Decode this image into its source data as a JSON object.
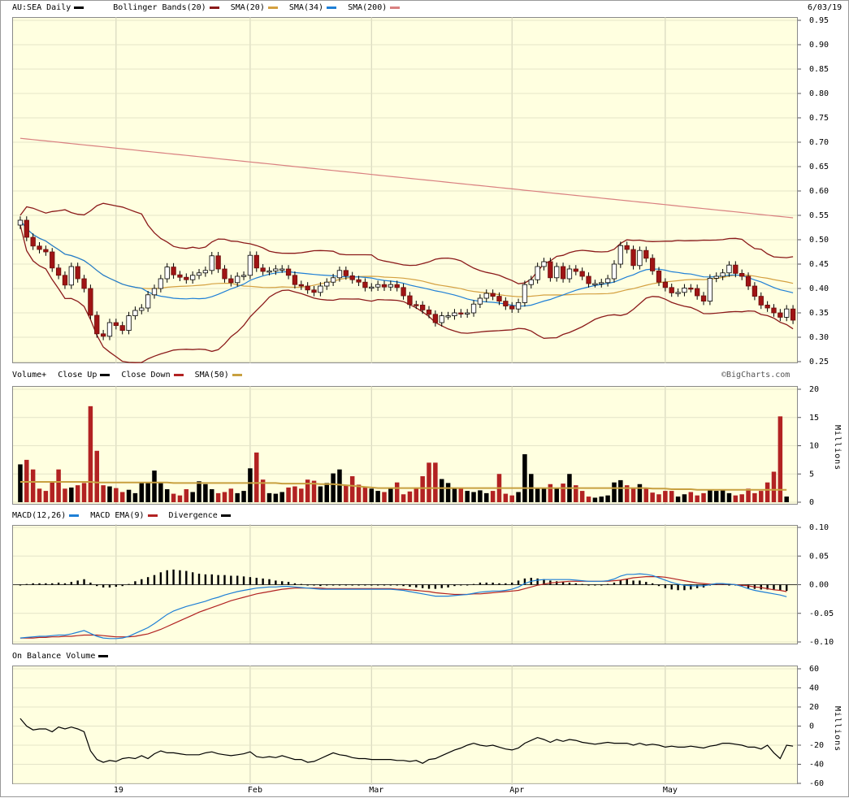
{
  "header": {
    "ticker": "AU:SEA Daily",
    "date": "6/03/19",
    "legend": [
      {
        "label": "AU:SEA Daily",
        "color": "#000000"
      },
      {
        "label": "Bollinger Bands(20)",
        "color": "#8b1a1a"
      },
      {
        "label": "SMA(20)",
        "color": "#b22222"
      },
      {
        "label": "SMA(34)",
        "color": "#d4a040"
      },
      {
        "label": "SMA(200)",
        "color": "#1e7fd6"
      },
      {
        "label": "",
        "color": "#d98080"
      }
    ]
  },
  "volume_panel": {
    "legend": [
      {
        "label": "Volume+",
        "color": null
      },
      {
        "label": "Close Up",
        "color": "#000000"
      },
      {
        "label": "Close Down",
        "color": "#b22222"
      },
      {
        "label": "SMA(50)",
        "color": "#c8a040"
      }
    ],
    "watermark": "©BigCharts.com",
    "unit_label": "Millions"
  },
  "macd_panel": {
    "legend": [
      {
        "label": "MACD(12,26)",
        "color": "#1e7fd6"
      },
      {
        "label": "MACD EMA(9)",
        "color": "#b22222"
      },
      {
        "label": "Divergence",
        "color": "#000000"
      }
    ]
  },
  "obv_panel": {
    "legend": [
      {
        "label": "On Balance Volume",
        "color": "#000000"
      }
    ],
    "unit_label": "Millions"
  },
  "x_axis": {
    "labels": [
      "19",
      "Feb",
      "Mar",
      "Apr",
      "May"
    ]
  },
  "chart_data": {
    "type": "candlestick",
    "title": "AU:SEA Daily",
    "price_ylim": [
      0.25,
      0.95
    ],
    "price_ticks": [
      "0.95",
      "0.90",
      "0.85",
      "0.80",
      "0.75",
      "0.70",
      "0.65",
      "0.60",
      "0.55",
      "0.50",
      "0.45",
      "0.40",
      "0.35",
      "0.30",
      "0.25"
    ],
    "volume_ylim": [
      0,
      20
    ],
    "volume_ticks": [
      "20",
      "15",
      "10",
      "5",
      "0"
    ],
    "macd_ylim": [
      -0.1,
      0.1
    ],
    "macd_ticks": [
      "0.10",
      "0.05",
      "0.00",
      "-0.05",
      "-0.10"
    ],
    "obv_ylim": [
      -60,
      60
    ],
    "obv_ticks": [
      "60",
      "40",
      "20",
      "0",
      "-20",
      "-40",
      "-60"
    ],
    "close": [
      0.54,
      0.505,
      0.487,
      0.48,
      0.475,
      0.442,
      0.427,
      0.407,
      0.445,
      0.42,
      0.4,
      0.345,
      0.307,
      0.302,
      0.33,
      0.324,
      0.314,
      0.344,
      0.355,
      0.36,
      0.387,
      0.4,
      0.42,
      0.444,
      0.428,
      0.423,
      0.418,
      0.427,
      0.432,
      0.437,
      0.467,
      0.44,
      0.42,
      0.412,
      0.425,
      0.427,
      0.468,
      0.442,
      0.435,
      0.436,
      0.44,
      0.44,
      0.427,
      0.408,
      0.405,
      0.397,
      0.392,
      0.405,
      0.413,
      0.422,
      0.437,
      0.426,
      0.418,
      0.413,
      0.402,
      0.403,
      0.408,
      0.403,
      0.408,
      0.402,
      0.385,
      0.367,
      0.366,
      0.356,
      0.347,
      0.33,
      0.344,
      0.344,
      0.35,
      0.348,
      0.35,
      0.368,
      0.38,
      0.39,
      0.384,
      0.374,
      0.364,
      0.358,
      0.371,
      0.408,
      0.418,
      0.445,
      0.455,
      0.422,
      0.445,
      0.42,
      0.44,
      0.435,
      0.425,
      0.41,
      0.41,
      0.412,
      0.42,
      0.45,
      0.488,
      0.48,
      0.447,
      0.478,
      0.462,
      0.436,
      0.413,
      0.402,
      0.391,
      0.392,
      0.401,
      0.4,
      0.385,
      0.374,
      0.421,
      0.425,
      0.432,
      0.448,
      0.431,
      0.425,
      0.405,
      0.384,
      0.366,
      0.36,
      0.35,
      0.341,
      0.358,
      0.335
    ],
    "volume": [
      6.7,
      7.5,
      5.8,
      2.4,
      2.0,
      3.5,
      5.8,
      2.4,
      2.6,
      3.0,
      3.4,
      17.0,
      9.1,
      3.0,
      2.8,
      2.5,
      1.8,
      2.2,
      1.6,
      3.5,
      3.5,
      5.6,
      3.6,
      2.3,
      1.5,
      1.2,
      2.3,
      1.8,
      3.7,
      3.2,
      2.3,
      1.6,
      1.8,
      2.4,
      1.6,
      2.0,
      6.0,
      8.8,
      4.0,
      1.6,
      1.5,
      1.8,
      2.6,
      2.8,
      2.4,
      4.0,
      3.8,
      2.8,
      3.4,
      5.1,
      5.8,
      3.0,
      4.6,
      3.1,
      2.7,
      2.4,
      2.0,
      1.8,
      2.6,
      3.5,
      1.4,
      1.9,
      2.6,
      4.6,
      7.0,
      7.0,
      4.1,
      3.4,
      2.4,
      2.4,
      2.0,
      1.8,
      2.1,
      1.6,
      2.0,
      5.0,
      1.5,
      1.2,
      1.8,
      8.5,
      5.0,
      2.4,
      2.4,
      3.2,
      2.4,
      3.3,
      5.0,
      3.0,
      2.0,
      1.0,
      0.8,
      1.0,
      1.2,
      3.5,
      3.9,
      3.0,
      2.4,
      3.2,
      2.4,
      1.7,
      1.4,
      2.0,
      2.0,
      1.0,
      1.4,
      1.8,
      1.2,
      1.6,
      2.2,
      2.0,
      2.1,
      1.6,
      1.2,
      1.4,
      2.4,
      1.6,
      2.0,
      3.5,
      5.4,
      15.2,
      1.0
    ],
    "sma50_volume": [
      3.6,
      3.6,
      3.6,
      3.6,
      3.6,
      3.6,
      3.6,
      3.6,
      3.6,
      3.6,
      3.6,
      3.6,
      3.5,
      3.5,
      3.5,
      3.5,
      3.5,
      3.5,
      3.5,
      3.5,
      3.5,
      3.5,
      3.5,
      3.5,
      3.4,
      3.4,
      3.4,
      3.4,
      3.4,
      3.4,
      3.4,
      3.4,
      3.4,
      3.4,
      3.4,
      3.4,
      3.4,
      3.4,
      3.4,
      3.4,
      3.4,
      3.3,
      3.3,
      3.3,
      3.3,
      3.3,
      3.3,
      3.2,
      3.2,
      3.2,
      3.1,
      3.0,
      2.9,
      2.8,
      2.7,
      2.6,
      2.5,
      2.5,
      2.5,
      2.5,
      2.5,
      2.5,
      2.5,
      2.5,
      2.5,
      2.5,
      2.5,
      2.5,
      2.5,
      2.5,
      2.5,
      2.5,
      2.5,
      2.5,
      2.5,
      2.5,
      2.5,
      2.5,
      2.5,
      2.5,
      2.5,
      2.5,
      2.5,
      2.5,
      2.5,
      2.5,
      2.5,
      2.5,
      2.5,
      2.5,
      2.5,
      2.5,
      2.5,
      2.5,
      2.5,
      2.5,
      2.5,
      2.5,
      2.5,
      2.4,
      2.4,
      2.4,
      2.3,
      2.3,
      2.3,
      2.3,
      2.2,
      2.2,
      2.2,
      2.2,
      2.2,
      2.2,
      2.2,
      2.2,
      2.2,
      2.2,
      2.2,
      2.2,
      2.2,
      2.2,
      2.2
    ],
    "sma200_start": 0.708,
    "sma200_end": 0.545,
    "macd_line": [
      -0.093,
      -0.092,
      -0.091,
      -0.09,
      -0.09,
      -0.089,
      -0.088,
      -0.088,
      -0.086,
      -0.083,
      -0.08,
      -0.085,
      -0.09,
      -0.093,
      -0.094,
      -0.094,
      -0.093,
      -0.09,
      -0.085,
      -0.08,
      -0.075,
      -0.068,
      -0.06,
      -0.052,
      -0.046,
      -0.042,
      -0.038,
      -0.035,
      -0.032,
      -0.029,
      -0.025,
      -0.022,
      -0.018,
      -0.015,
      -0.012,
      -0.01,
      -0.008,
      -0.006,
      -0.005,
      -0.004,
      -0.004,
      -0.003,
      -0.003,
      -0.004,
      -0.005,
      -0.006,
      -0.007,
      -0.008,
      -0.008,
      -0.008,
      -0.008,
      -0.008,
      -0.008,
      -0.008,
      -0.008,
      -0.008,
      -0.008,
      -0.008,
      -0.008,
      -0.009,
      -0.01,
      -0.012,
      -0.014,
      -0.016,
      -0.018,
      -0.02,
      -0.02,
      -0.02,
      -0.019,
      -0.018,
      -0.017,
      -0.015,
      -0.013,
      -0.012,
      -0.011,
      -0.011,
      -0.01,
      -0.008,
      -0.004,
      0.002,
      0.006,
      0.008,
      0.009,
      0.009,
      0.009,
      0.009,
      0.009,
      0.008,
      0.007,
      0.006,
      0.006,
      0.006,
      0.007,
      0.01,
      0.015,
      0.018,
      0.018,
      0.019,
      0.018,
      0.016,
      0.012,
      0.008,
      0.004,
      0.001,
      -0.001,
      -0.002,
      -0.002,
      -0.002,
      0.0,
      0.002,
      0.002,
      0.001,
      0.0,
      -0.003,
      -0.007,
      -0.01,
      -0.012,
      -0.014,
      -0.016,
      -0.018,
      -0.021
    ],
    "macd_signal": [
      -0.093,
      -0.093,
      -0.093,
      -0.092,
      -0.092,
      -0.091,
      -0.091,
      -0.09,
      -0.09,
      -0.089,
      -0.088,
      -0.088,
      -0.088,
      -0.089,
      -0.09,
      -0.091,
      -0.091,
      -0.091,
      -0.09,
      -0.088,
      -0.086,
      -0.082,
      -0.078,
      -0.073,
      -0.068,
      -0.063,
      -0.058,
      -0.053,
      -0.048,
      -0.044,
      -0.04,
      -0.036,
      -0.032,
      -0.028,
      -0.025,
      -0.022,
      -0.019,
      -0.016,
      -0.014,
      -0.012,
      -0.01,
      -0.008,
      -0.007,
      -0.006,
      -0.006,
      -0.006,
      -0.006,
      -0.006,
      -0.007,
      -0.007,
      -0.007,
      -0.007,
      -0.007,
      -0.007,
      -0.007,
      -0.007,
      -0.007,
      -0.007,
      -0.007,
      -0.008,
      -0.008,
      -0.009,
      -0.01,
      -0.011,
      -0.012,
      -0.014,
      -0.015,
      -0.016,
      -0.017,
      -0.017,
      -0.017,
      -0.016,
      -0.016,
      -0.015,
      -0.014,
      -0.013,
      -0.012,
      -0.011,
      -0.01,
      -0.007,
      -0.004,
      -0.001,
      0.001,
      0.003,
      0.004,
      0.005,
      0.006,
      0.006,
      0.006,
      0.006,
      0.006,
      0.006,
      0.006,
      0.007,
      0.008,
      0.01,
      0.012,
      0.013,
      0.014,
      0.014,
      0.014,
      0.013,
      0.011,
      0.009,
      0.007,
      0.005,
      0.003,
      0.002,
      0.001,
      0.001,
      0.001,
      0.001,
      0.0,
      -0.001,
      -0.002,
      -0.004,
      -0.005,
      -0.007,
      -0.009,
      -0.01,
      -0.012
    ],
    "obv": [
      8,
      0,
      -4,
      -3,
      -3,
      -6,
      -1,
      -3,
      -1,
      -3,
      -6,
      -26,
      -35,
      -38,
      -36,
      -37,
      -34,
      -33,
      -34,
      -31,
      -34,
      -29,
      -26,
      -28,
      -28,
      -29,
      -30,
      -30,
      -30,
      -28,
      -27,
      -29,
      -30,
      -31,
      -30,
      -29,
      -27,
      -32,
      -33,
      -32,
      -33,
      -31,
      -33,
      -35,
      -35,
      -38,
      -37,
      -34,
      -31,
      -28,
      -30,
      -31,
      -33,
      -34,
      -34,
      -35,
      -35,
      -35,
      -35,
      -36,
      -36,
      -37,
      -36,
      -39,
      -35,
      -34,
      -31,
      -28,
      -25,
      -23,
      -20,
      -18,
      -20,
      -21,
      -20,
      -22,
      -24,
      -25,
      -23,
      -18,
      -15,
      -12,
      -14,
      -17,
      -14,
      -16,
      -14,
      -15,
      -17,
      -18,
      -19,
      -18,
      -17,
      -18,
      -18,
      -18,
      -20,
      -18,
      -20,
      -19,
      -20,
      -22,
      -21,
      -22,
      -22,
      -21,
      -22,
      -23,
      -21,
      -20,
      -18,
      -18,
      -19,
      -20,
      -22,
      -22,
      -24,
      -20,
      -28,
      -34,
      -20,
      -21
    ]
  }
}
